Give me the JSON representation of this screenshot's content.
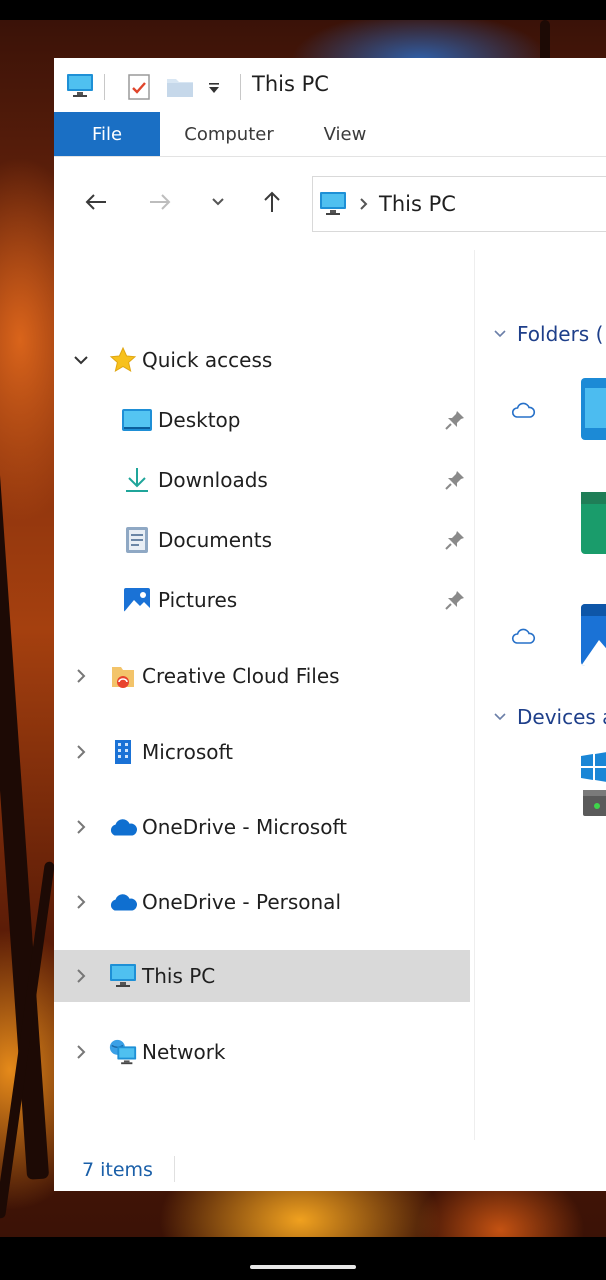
{
  "window": {
    "title": "This PC"
  },
  "ribbon": {
    "tabs": [
      {
        "label": "File",
        "active": true
      },
      {
        "label": "Computer",
        "active": false
      },
      {
        "label": "View",
        "active": false
      }
    ]
  },
  "address_bar": {
    "path": "This PC",
    "icon": "this-pc-icon"
  },
  "navigation_pane": {
    "items": [
      {
        "label": "Quick access",
        "icon": "star-icon",
        "expanded": true
      },
      {
        "label": "Desktop",
        "icon": "desktop-folder-icon",
        "pinned": true
      },
      {
        "label": "Downloads",
        "icon": "download-icon",
        "pinned": true
      },
      {
        "label": "Documents",
        "icon": "documents-icon",
        "pinned": true
      },
      {
        "label": "Pictures",
        "icon": "pictures-icon",
        "pinned": true
      },
      {
        "label": "Creative Cloud Files",
        "icon": "creative-cloud-icon",
        "expanded": false
      },
      {
        "label": "Microsoft",
        "icon": "building-icon",
        "expanded": false
      },
      {
        "label": "OneDrive - Microsoft",
        "icon": "onedrive-icon",
        "expanded": false
      },
      {
        "label": "OneDrive - Personal",
        "icon": "onedrive-icon",
        "expanded": false
      },
      {
        "label": "This PC",
        "icon": "this-pc-icon",
        "expanded": false,
        "selected": true
      },
      {
        "label": "Network",
        "icon": "network-icon",
        "expanded": false
      }
    ]
  },
  "content": {
    "groups": [
      {
        "label": "Folders ("
      },
      {
        "label": "Devices a"
      }
    ]
  },
  "status": {
    "items_count": "7 items"
  },
  "colors": {
    "accent": "#1a6fc4",
    "group_header": "#1e3f8a",
    "selected_row": "#d9d9d9"
  }
}
